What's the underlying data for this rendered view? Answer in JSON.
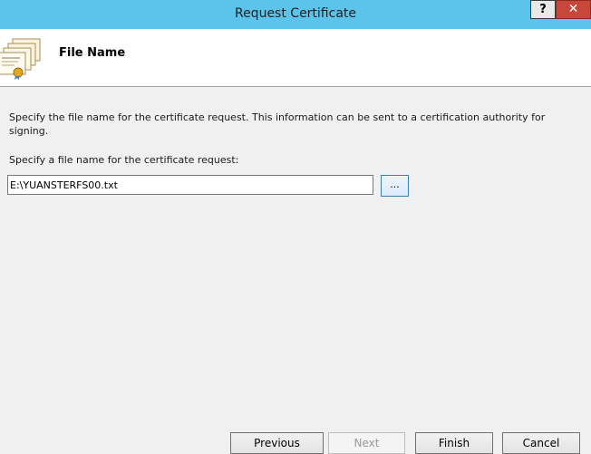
{
  "window": {
    "title": "Request Certificate",
    "help_label": "?",
    "close_label": "✕"
  },
  "header": {
    "title": "File Name",
    "icon": "certificate-stack-icon"
  },
  "main": {
    "description": "Specify the file name for the certificate request. This information can be sent to a certification authority for signing.",
    "field_label": "Specify a file name for the certificate request:",
    "filename_value": "E:\\YUANSTERFS00.txt",
    "browse_label": "..."
  },
  "buttons": {
    "previous": "Previous",
    "next": "Next",
    "finish": "Finish",
    "cancel": "Cancel"
  },
  "colors": {
    "titlebar": "#5cc4ea",
    "close_button": "#c7473a"
  }
}
